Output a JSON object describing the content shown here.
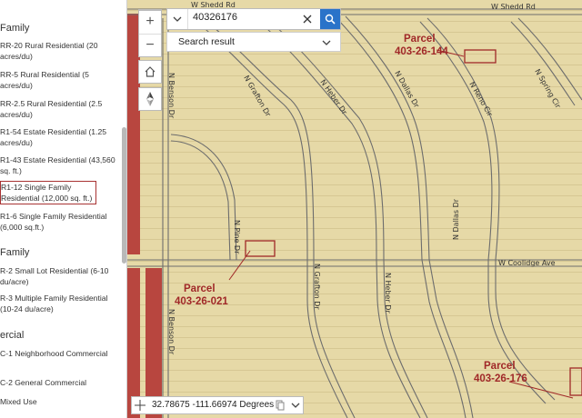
{
  "legend": {
    "headers": [
      "Family",
      "Family",
      "ercial"
    ],
    "items": [
      {
        "text": "RR-20 Rural Residential (20 acres/du)"
      },
      {
        "text": "RR-5 Rural Residential (5 acres/du)"
      },
      {
        "text": "RR-2.5 Rural Residential (2.5 acres/du)"
      },
      {
        "text": "R1-54 Estate Residential (1.25 acres/du)"
      },
      {
        "text": "R1-43 Estate Residential (43,560 sq. ft.)"
      },
      {
        "text": "R1-12 Single Family Residential (12,000 sq. ft.)",
        "selected": true
      },
      {
        "text": "R1-6 Single Family Residential (6,000 sq.ft.)"
      },
      {
        "text": "R-2 Small Lot Residential (6-10 du/acre)"
      },
      {
        "text": "R-3 Multiple Family Residential (10-24 du/acre)"
      },
      {
        "text": "C-1 Neighborhood Commercial"
      },
      {
        "text": "C-2 General Commercial"
      },
      {
        "text": "Mixed Use"
      }
    ]
  },
  "search": {
    "value": "40326176",
    "dropdown_label": "Search result"
  },
  "controls": {
    "zoom_in": "+",
    "zoom_out": "−"
  },
  "coordinates": {
    "text": "32.78675 -111.66974 Degrees"
  },
  "roads": {
    "shedd": "W Shedd Rd",
    "coolidge": "W Coolidge Ave",
    "benson": "N Benson Dr",
    "grafton": "N Grafton Dr",
    "heber": "N Heber Dr",
    "dallas": "N Dallas Dr",
    "reno": "N Reno Cir",
    "spring": "N Spring Cir",
    "pine": "N Pine Dr"
  },
  "parcels": [
    {
      "label": "Parcel",
      "number": "403-26-144"
    },
    {
      "label": "Parcel",
      "number": "403-26-021"
    },
    {
      "label": "Parcel",
      "number": "403-26-176"
    }
  ],
  "colors": {
    "zone_fill": "#e6d9a7",
    "commercial_red": "#b8463f",
    "parcel_label": "#a02828",
    "search_button": "#2a73c9"
  }
}
